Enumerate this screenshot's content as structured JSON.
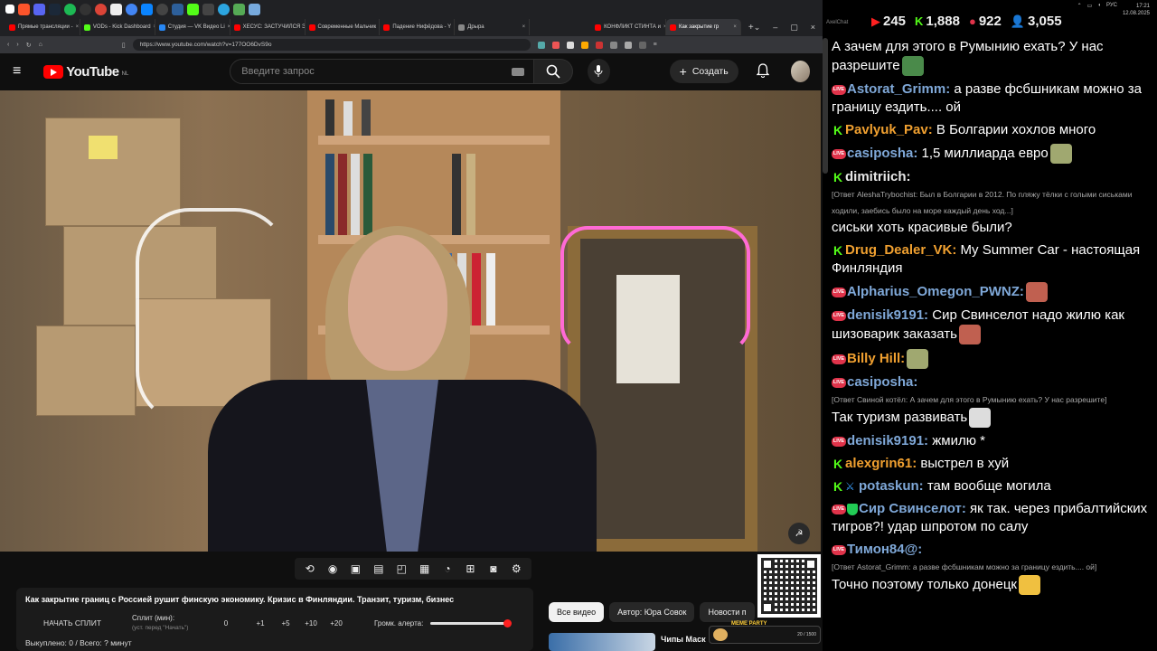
{
  "browser": {
    "tabs": [
      {
        "label": "Прямые трансляции - ",
        "color": "#ff0000"
      },
      {
        "label": "VODs - Kick Dashboard",
        "color": "#53fc18"
      },
      {
        "label": "Студия — VK Видео Li",
        "color": "#2787f5"
      },
      {
        "label": "ХЕСУС: ЗАСТУЧИЛСЯ Э",
        "color": "#ff0000"
      },
      {
        "label": "Современные Мальчик",
        "color": "#ff0000"
      },
      {
        "label": "Падение Нифёдова - Y",
        "color": "#ff0000"
      },
      {
        "label": "Дрыра",
        "color": "#888888"
      },
      {
        "label": "КОНФЛИКТ СТИНТА и",
        "color": "#ff0000"
      },
      {
        "label": "Как закрытие гр",
        "color": "#ff0000"
      }
    ],
    "new_tab": "+",
    "url": "https://www.youtube.com/watch?v=177OO6DvS9o"
  },
  "youtube": {
    "logo_text": "YouTube",
    "country": "NL",
    "search_placeholder": "Введите запрос",
    "create_label": "Создать",
    "video_title": "Как закрытие границ с Россией рушит финскую экономику. Кризис в Финляндии. Транзит, туризм, бизнес",
    "chips": [
      "Все видео",
      "Автор: Юра Совок",
      "Новости п"
    ],
    "rec_title": "Чипы Маск"
  },
  "split_panel": {
    "start_label": "НАЧАТЬ СПЛИТ",
    "split_label": "Сплит (мин):",
    "split_hint": "(уст. перед \"Начать\")",
    "current": "0",
    "increments": [
      "+1",
      "+5",
      "+10",
      "+20"
    ],
    "volume_label": "Громк. алерта:",
    "volume_level": 1.0,
    "sold": "Выкуплено: 0 / Всего: ? минут"
  },
  "overlay": {
    "meme_label": "MEME PARTY",
    "meme_count": "20 / 1500"
  },
  "chat": {
    "app_label": "AxelChat",
    "stats": [
      {
        "icon": "youtube-icon",
        "value": "245",
        "color": "#ff2020"
      },
      {
        "icon": "kick-icon",
        "value": "1,888",
        "color": "#53fc18"
      },
      {
        "icon": "live-icon",
        "value": "922",
        "color": "#e0334a"
      },
      {
        "icon": "viewers-icon",
        "value": "3,055",
        "color": "#3aa0ff"
      }
    ],
    "tray_lang": "РУС",
    "time": "17:21",
    "date": "12.08.2025",
    "messages": [
      {
        "platform": "none",
        "user": "",
        "user_color": "#ffffff",
        "reply": "",
        "text": "А зачем для этого в Румынию ехать? У нас разрешите",
        "emote": "#4a8a4a"
      },
      {
        "platform": "live",
        "user": "Astorat_Grimm:",
        "user_color": "#7fa8d8",
        "reply": "",
        "text": " а разве фсбшникам можно за границу ездить.... ой",
        "emote": ""
      },
      {
        "platform": "kick",
        "user": "Pavlyuk_Pav:",
        "user_color": "#f0a030",
        "reply": "",
        "text": " В Болгарии хохлов много",
        "emote": ""
      },
      {
        "platform": "live",
        "user": "casiposha:",
        "user_color": "#7fa8d8",
        "reply": "",
        "text": " 1,5 миллиарда евро",
        "emote": "#a0a870"
      },
      {
        "platform": "kick",
        "user": "dimitriich:",
        "user_color": "#e8e8e8",
        "reply": "[Ответ AleshaTrybochist: Был в Болгарии в 2012. По пляжу тёлки с голыми сиськами ходили, заебись было на море каждый день ход...]",
        "text": "сиськи хоть красивые были?",
        "emote": ""
      },
      {
        "platform": "kick",
        "user": "Drug_Dealer_VK:",
        "user_color": "#f0a030",
        "reply": "",
        "text": " My Summer Car - настоящая Финляндия",
        "emote": ""
      },
      {
        "platform": "live",
        "user": "Alpharius_Omegon_PWNZ:",
        "user_color": "#7fa8d8",
        "reply": "",
        "text": "",
        "emote": "#c06050"
      },
      {
        "platform": "live",
        "user": "denisik9191:",
        "user_color": "#7fa8d8",
        "reply": "",
        "text": " Сир Свинселот надо жилю как шизоварик заказать",
        "emote": "#c06050"
      },
      {
        "platform": "live",
        "user": "Billy Hill:",
        "user_color": "#f0a030",
        "reply": "",
        "text": "",
        "emote": "#a0a870"
      },
      {
        "platform": "live",
        "user": "casiposha:",
        "user_color": "#7fa8d8",
        "reply": "[Ответ Свиной котёл: А зачем для этого в Румынию ехать? У нас разрешите]",
        "text": "Так туризм развивать",
        "emote": "#dddddd"
      },
      {
        "platform": "live",
        "user": "denisik9191:",
        "user_color": "#7fa8d8",
        "reply": "",
        "text": " жмилю *",
        "emote": ""
      },
      {
        "platform": "kick",
        "user": "alexgrin61:",
        "user_color": "#f0a030",
        "reply": "",
        "text": " выстрел в хуй",
        "emote": ""
      },
      {
        "platform": "kick-sword",
        "user": "potaskun:",
        "user_color": "#7fa8d8",
        "reply": "",
        "text": " там вообще могила",
        "emote": ""
      },
      {
        "platform": "live-shield",
        "user": "Сир Свинселот:",
        "user_color": "#7fa8d8",
        "reply": "",
        "text": " як так. через прибалтийских тигров?! удар шпротом по салу",
        "emote": ""
      },
      {
        "platform": "live",
        "user": "Тимон84@:",
        "user_color": "#7fa8d8",
        "reply": "[Ответ Astorat_Grimm: а разве фсбшникам можно за границу ездить.... ой]",
        "text": "Точно поэтому только донецк",
        "emote": "#f0c040"
      }
    ]
  }
}
